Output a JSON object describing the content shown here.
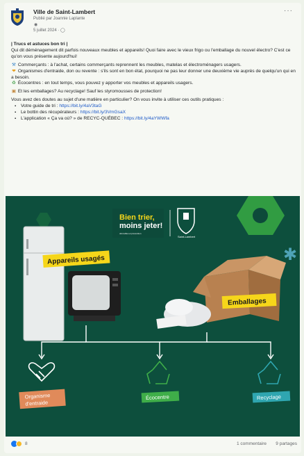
{
  "post": {
    "page_name": "Ville de Saint-Lambert",
    "published_by": "Publié par Joannie Laplante",
    "date": "5 juillet 2024 · ",
    "more": "···",
    "title": "| Trucs et astuces bon tri |",
    "intro": "Qui dit déménagement dit parfois nouveaux meubles et appareils! Quoi faire avec le vieux frigo ou l'emballage du nouvel électro? C'est ce qu'on vous présente aujourd'hui!",
    "items": [
      {
        "icon": "broom-icon",
        "glyph": "⚒",
        "color": "#3a86c8",
        "text": "Commerçants : à l'achat, certains commerçants reprennent les meubles, matelas et électroménagers usagers."
      },
      {
        "icon": "heart-hands-icon",
        "glyph": "❤",
        "color": "#e8a020",
        "text": "Organismes d'entraide, don ou revente : s'ils sont en bon état, pourquoi ne pas leur donner une deuxième vie auprès de quelqu'un qui en a besoin."
      },
      {
        "icon": "recycle-icon",
        "glyph": "♻",
        "color": "#3a9a40",
        "text": "Écocentres : en tout temps, vous pouvez y apporter vos meubles et appareils usagers."
      }
    ],
    "packaging": {
      "icon": "box-icon",
      "glyph": "▣",
      "color": "#c0843a",
      "text": "Et les emballages? Au recyclage! Sauf les styromousses de protection!"
    },
    "doubts": "Vous avez des doutes au sujet d'une matière en particulier? On vous invite à utiliser ces outils pratiques :",
    "links": [
      {
        "label": "Votre guide de tri : ",
        "url": "https://bit.ly/4aV3taG"
      },
      {
        "label": "Le bottin des récupérateurs : ",
        "url": "https://bit.ly/3VmGsaX"
      },
      {
        "label": "L'application « Ça va où? » de RECYC-QUÉBEC : ",
        "url": "https://bit.ly/4aYWWfa"
      }
    ]
  },
  "poster": {
    "slogan_line1": "Bien trier,",
    "slogan_line2": "moins jeter!",
    "slogan_small": "obnovilles et prévention",
    "crest_caption": "Saint-Lambert",
    "tag_appliances": "Appareils usagés",
    "tag_packaging": "Emballages",
    "dest_1": "Organisme d'entraide",
    "dest_1_line1": "Organisme",
    "dest_1_line2": "d'entraide",
    "dest_2": "Écocentre",
    "dest_3": "Recyclage",
    "colors": {
      "bg": "#0d4a3a",
      "yellow": "#f6d61a",
      "green_tag": "#3fae49",
      "teal_tag": "#2fa6b0",
      "coral_tag": "#e08a5a"
    }
  },
  "footer": {
    "reactions": "8",
    "comments": "1 commentaire",
    "shares": "9 partages"
  }
}
